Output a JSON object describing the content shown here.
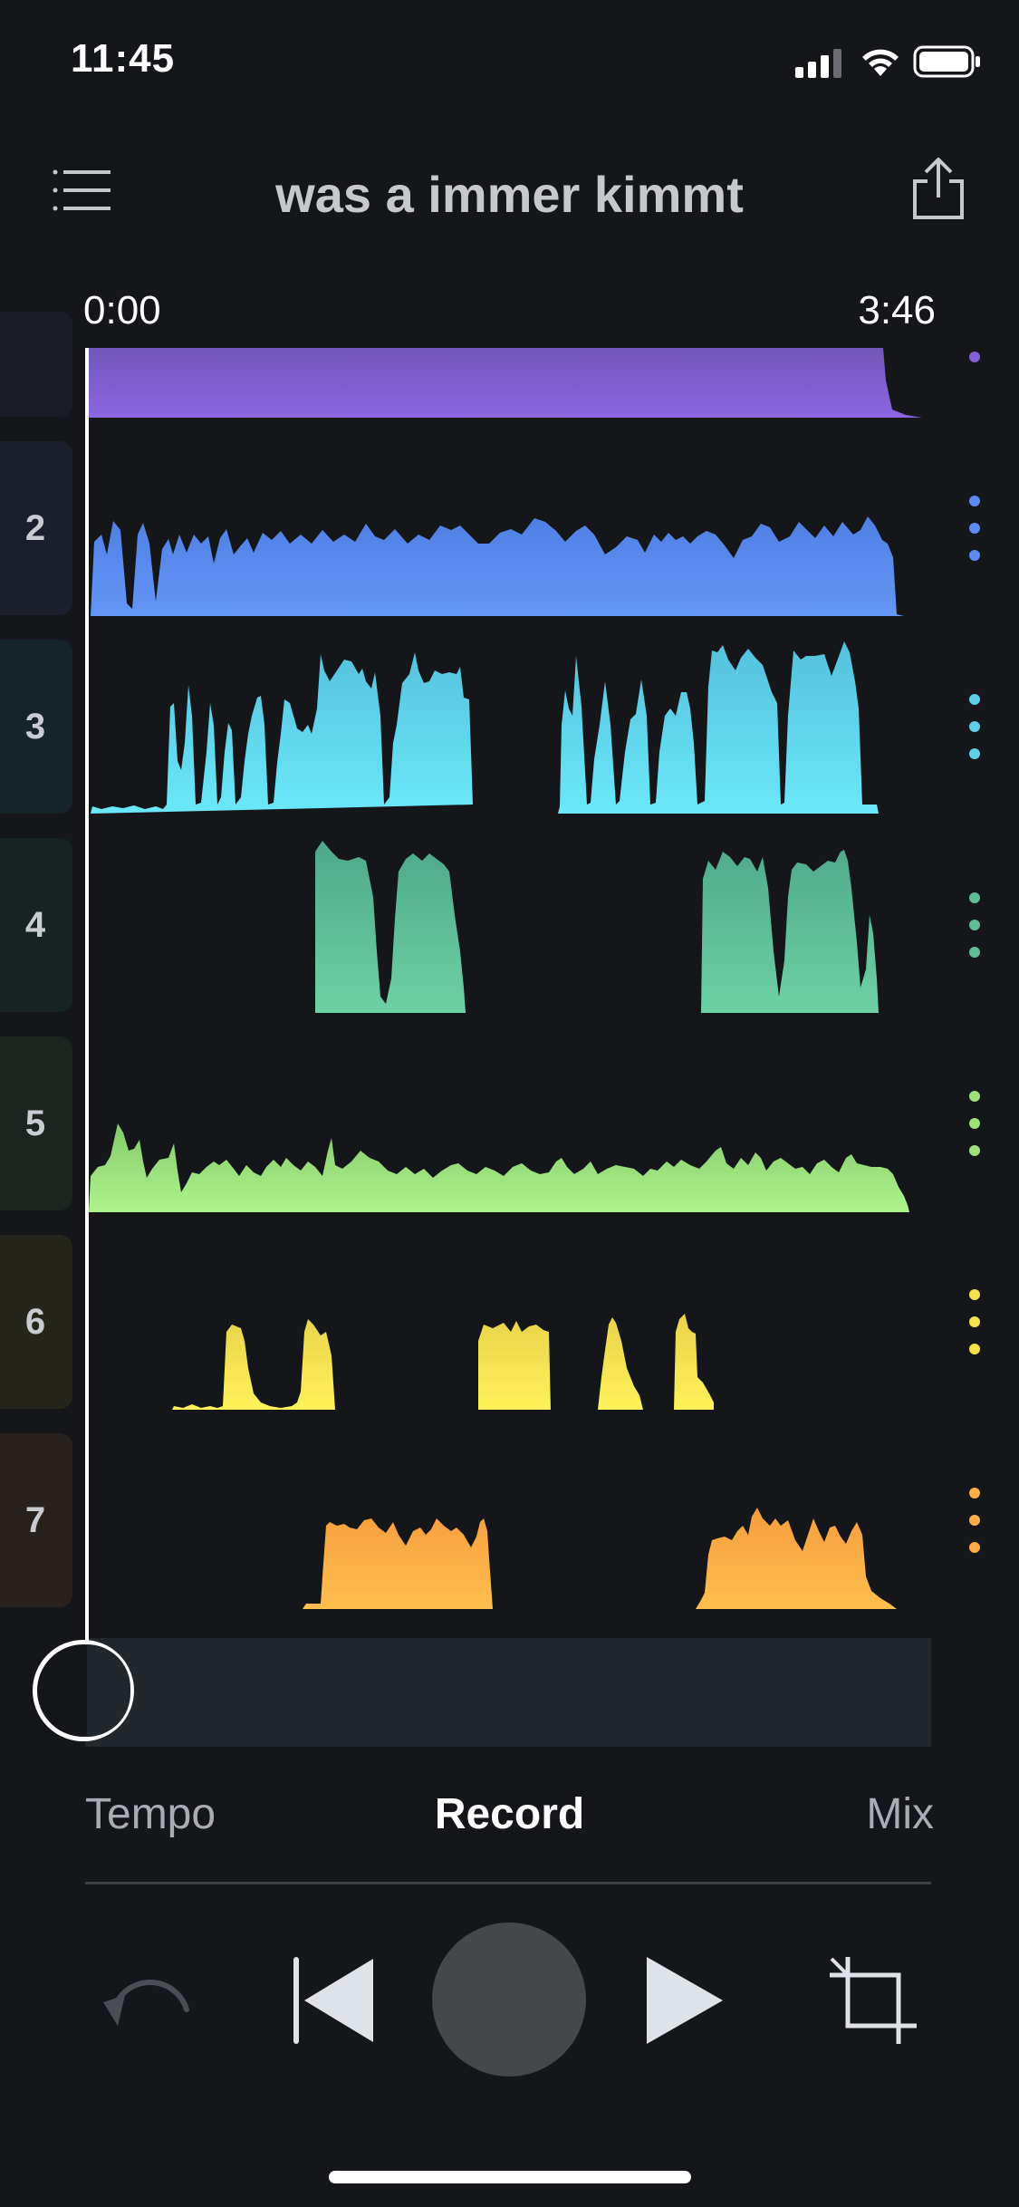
{
  "status_bar": {
    "time": "11:45"
  },
  "header": {
    "title": "was a immer kimmt",
    "menu_icon": "list-icon",
    "share_icon": "share-icon"
  },
  "timeline": {
    "start": "0:00",
    "end": "3:46"
  },
  "tracks": [
    {
      "number": "",
      "color": "#8160d8"
    },
    {
      "number": "2",
      "color": "#5c8cf0"
    },
    {
      "number": "3",
      "color": "#5ecfe6"
    },
    {
      "number": "4",
      "color": "#5fbd96"
    },
    {
      "number": "5",
      "color": "#9ee07a"
    },
    {
      "number": "6",
      "color": "#f4e24c"
    },
    {
      "number": "7",
      "color": "#ffae45"
    }
  ],
  "tabs": {
    "left": "Tempo",
    "center": "Record",
    "right": "Mix",
    "active": "Record"
  },
  "transport": {
    "undo_icon": "undo-icon",
    "rewind_icon": "skip-back-icon",
    "record_icon": "record-button",
    "play_icon": "play-icon",
    "crop_icon": "crop-icon"
  }
}
